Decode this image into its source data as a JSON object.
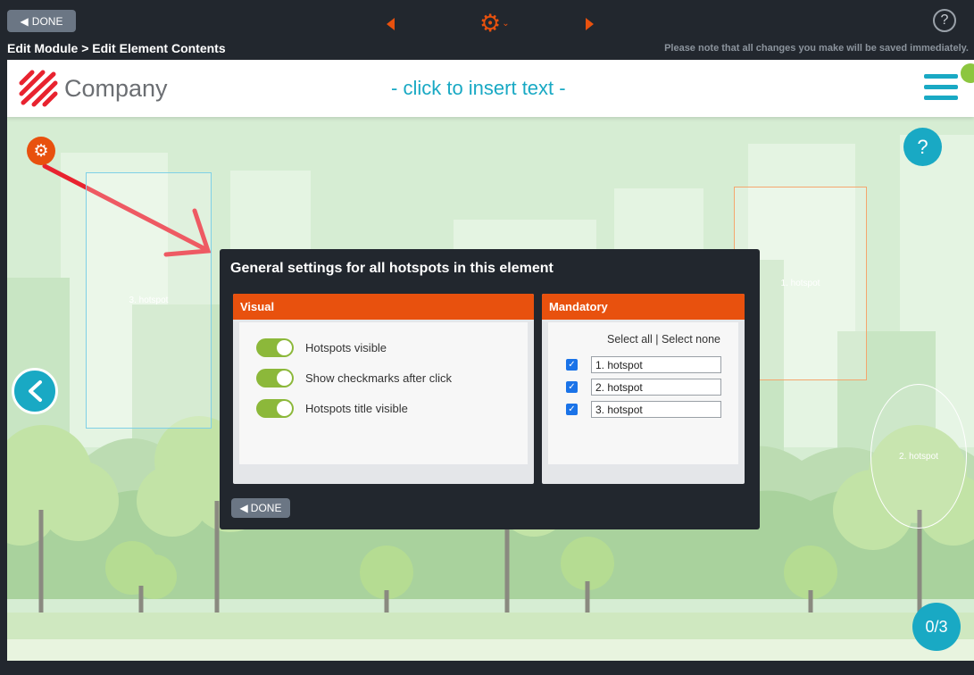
{
  "toolbar": {
    "done_label": "DONE",
    "breadcrumb": "Edit Module > Edit Element Contents",
    "notice": "Please note that all changes you make will be saved immediately.",
    "help_label": "?"
  },
  "header": {
    "company": "Company",
    "insert_text": "- click to insert text -"
  },
  "stage": {
    "help_label": "?",
    "counter": "0/3",
    "hotspots": [
      {
        "label": "1. hotspot"
      },
      {
        "label": "2. hotspot"
      },
      {
        "label": "3. hotspot"
      }
    ]
  },
  "dialog": {
    "title": "General settings for all hotspots in this element",
    "visual": {
      "heading": "Visual",
      "toggles": [
        {
          "label": "Hotspots visible",
          "on": true
        },
        {
          "label": "Show checkmarks after click",
          "on": true
        },
        {
          "label": "Hotspots title visible",
          "on": true
        }
      ]
    },
    "mandatory": {
      "heading": "Mandatory",
      "select_all": "Select all",
      "separator": "|",
      "select_none": "Select none",
      "items": [
        {
          "value": "1. hotspot",
          "checked": true
        },
        {
          "value": "2. hotspot",
          "checked": true
        },
        {
          "value": "3. hotspot",
          "checked": true
        }
      ]
    },
    "done_label": "DONE"
  },
  "colors": {
    "accent_orange": "#e8510e",
    "accent_teal": "#19a9c4",
    "toggle_green": "#8cb83a",
    "toolbar_bg": "#22272e"
  }
}
